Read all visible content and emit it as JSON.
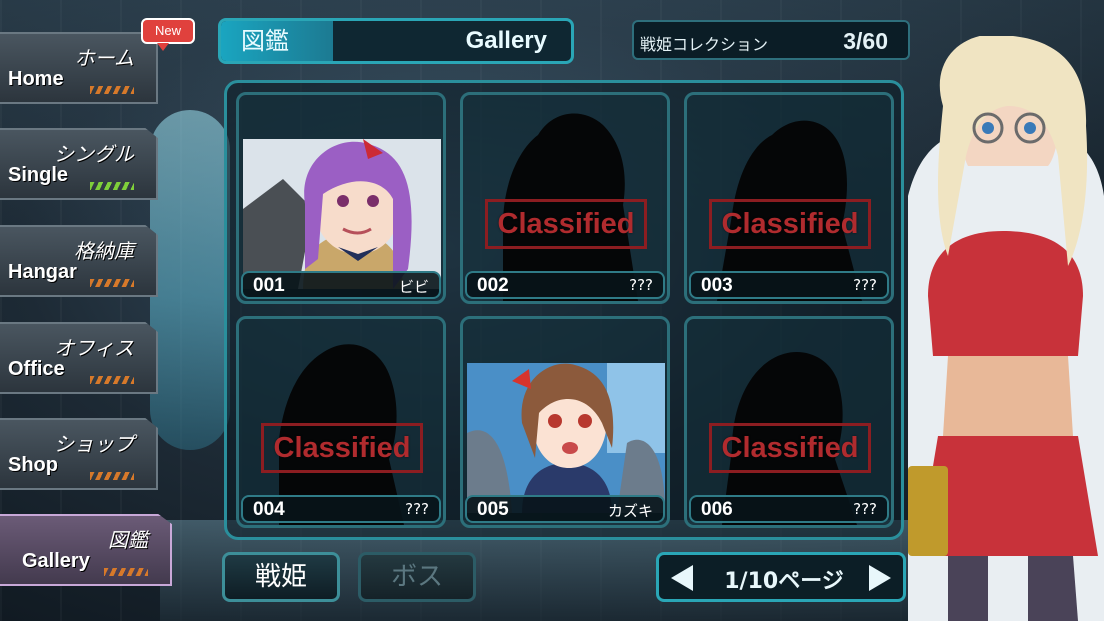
{
  "sidebar": {
    "items": [
      {
        "jp": "ホーム",
        "en": "Home",
        "badge": "New",
        "stripe": "orange"
      },
      {
        "jp": "シングル",
        "en": "Single",
        "stripe": "green"
      },
      {
        "jp": "格納庫",
        "en": "Hangar",
        "stripe": "orange"
      },
      {
        "jp": "オフィス",
        "en": "Office",
        "stripe": "orange"
      },
      {
        "jp": "ショップ",
        "en": "Shop",
        "stripe": "orange"
      },
      {
        "jp": "図鑑",
        "en": "Gallery",
        "stripe": "orange",
        "active": true
      }
    ]
  },
  "header": {
    "tab_jp": "図鑑",
    "title_en": "Gallery",
    "collection_label": "戦姫コレクション",
    "collection_count": "3/60"
  },
  "cards": [
    {
      "num": "001",
      "name": "ビビ",
      "status": "unlocked"
    },
    {
      "num": "002",
      "name": "???",
      "status": "classified",
      "stamp": "Classified"
    },
    {
      "num": "003",
      "name": "???",
      "status": "classified",
      "stamp": "Classified"
    },
    {
      "num": "004",
      "name": "???",
      "status": "classified",
      "stamp": "Classified"
    },
    {
      "num": "005",
      "name": "カズキ",
      "status": "unlocked"
    },
    {
      "num": "006",
      "name": "???",
      "status": "classified",
      "stamp": "Classified"
    }
  ],
  "tabs": {
    "senki": "戦姫",
    "boss": "ボス"
  },
  "pager": {
    "page_text": "1/10ページ"
  },
  "colors": {
    "accent": "#2aa6b6",
    "classified_red": "#b02b2e",
    "badge_red": "#e0413d"
  }
}
